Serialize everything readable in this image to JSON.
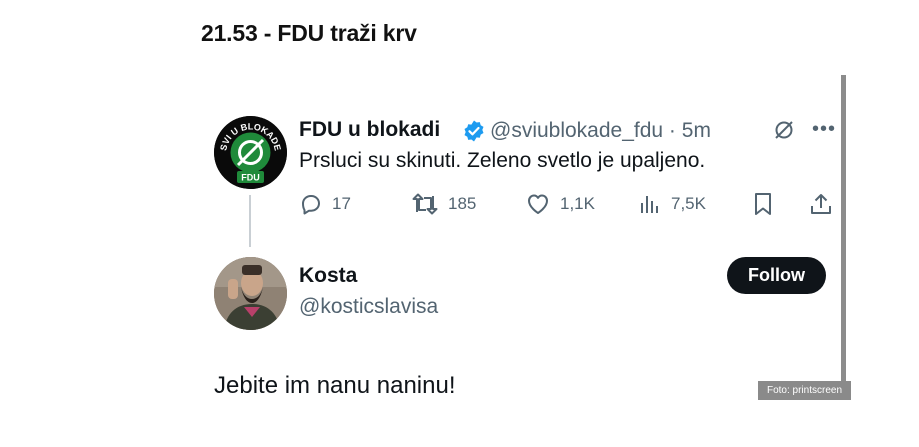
{
  "headline": "21.53 - FDU traži krv",
  "tweet": {
    "author_name": "FDU u blokadi",
    "handle_time": "@sviublokade_fdu · 5m",
    "avatar_top_text": "SVI U BLOKADE",
    "avatar_bottom_text": "FDU",
    "text": "Prsluci su skinuti. Zeleno svetlo je upaljeno.",
    "actions": {
      "replies": "17",
      "reposts": "185",
      "likes": "1,1K",
      "views": "7,5K"
    }
  },
  "reply": {
    "author_name": "Kosta",
    "handle": "@kosticslavisa",
    "follow_label": "Follow",
    "text": "Jebite im nanu naninu!"
  },
  "credit": "Foto: printscreen",
  "colors": {
    "verified": "#1d9bf0",
    "fdu_green": "#1f8a3a",
    "secondary_text": "#536471"
  }
}
